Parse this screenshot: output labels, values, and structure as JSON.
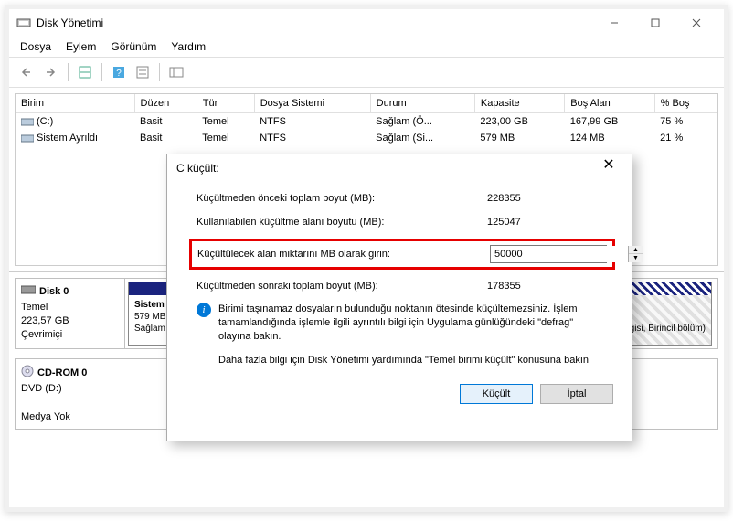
{
  "window": {
    "title": "Disk Yönetimi",
    "controls": {
      "minimize": "–",
      "maximize": "☐",
      "close": "✕"
    }
  },
  "menu": [
    "Dosya",
    "Eylem",
    "Görünüm",
    "Yardım"
  ],
  "table": {
    "headers": [
      "Birim",
      "Düzen",
      "Tür",
      "Dosya Sistemi",
      "Durum",
      "Kapasite",
      "Boş Alan",
      "% Boş"
    ],
    "rows": [
      {
        "name": "(C:)",
        "layout": "Basit",
        "type": "Temel",
        "fs": "NTFS",
        "status": "Sağlam (Ö...",
        "capacity": "223,00 GB",
        "free": "167,99 GB",
        "pct": "75 %"
      },
      {
        "name": "Sistem Ayrıldı",
        "layout": "Basit",
        "type": "Temel",
        "fs": "NTFS",
        "status": "Sağlam (Si...",
        "capacity": "579 MB",
        "free": "124 MB",
        "pct": "21 %"
      }
    ]
  },
  "disks": {
    "disk0": {
      "name": "Disk 0",
      "type": "Temel",
      "size": "223,57 GB",
      "status": "Çevrimiçi"
    },
    "part0": {
      "name": "Sistem",
      "size": "579 MB",
      "status": "Sağlam"
    },
    "part1_tail": "Bilgisi, Birincil bölüm)",
    "cdrom": {
      "name": "CD-ROM 0",
      "line2": "DVD (D:)",
      "media": "Medya Yok"
    }
  },
  "dialog": {
    "title": "C küçült:",
    "before_label": "Küçültmeden önceki toplam boyut (MB):",
    "before_val": "228355",
    "avail_label": "Kullanılabilen küçültme alanı boyutu (MB):",
    "avail_val": "125047",
    "amount_label": "Küçültülecek alan miktarını MB olarak girin:",
    "amount_val": "50000",
    "after_label": "Küçültmeden sonraki toplam boyut (MB):",
    "after_val": "178355",
    "info_text": "Birimi taşınamaz dosyaların bulunduğu noktanın ötesinde küçültemezsiniz. İşlem tamamlandığında işlemle ilgili ayrıntılı bilgi için Uygulama günlüğündeki \"defrag\" olayına bakın.",
    "more_text": "Daha fazla bilgi için Disk Yönetimi yardımında \"Temel birimi küçült\" konusuna bakın",
    "shrink_btn": "Küçült",
    "cancel_btn": "İptal"
  }
}
